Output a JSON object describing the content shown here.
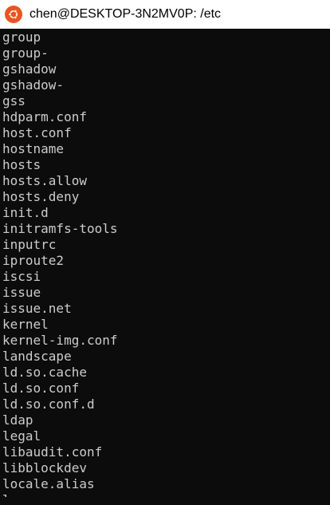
{
  "window": {
    "title": "chen@DESKTOP-3N2MV0P: /etc",
    "icon": "ubuntu-icon",
    "colors": {
      "background": "#0c0c0c",
      "text": "#cccccc",
      "titlebar": "#ffffff",
      "icon": "#e95420"
    }
  },
  "terminal": {
    "lines": [
      "group",
      "group-",
      "gshadow",
      "gshadow-",
      "gss",
      "hdparm.conf",
      "host.conf",
      "hostname",
      "hosts",
      "hosts.allow",
      "hosts.deny",
      "init.d",
      "initramfs-tools",
      "inputrc",
      "iproute2",
      "iscsi",
      "issue",
      "issue.net",
      "kernel",
      "kernel-img.conf",
      "landscape",
      "ld.so.cache",
      "ld.so.conf",
      "ld.so.conf.d",
      "ldap",
      "legal",
      "libaudit.conf",
      "libblockdev",
      "locale.alias",
      "l"
    ]
  }
}
